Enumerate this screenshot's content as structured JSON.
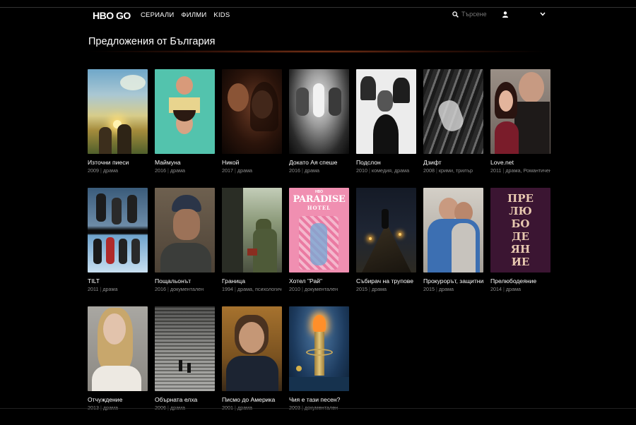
{
  "nav": {
    "logo": "HBO GO",
    "menu": [
      {
        "label": "СЕРИАЛИ"
      },
      {
        "label": "ФИЛМИ"
      },
      {
        "label": "KIDS"
      }
    ],
    "search_placeholder": "Търсене"
  },
  "page_title": "Предложения от България",
  "movies": [
    {
      "title": "Източни пиеси",
      "year": "2009",
      "genre": "драма"
    },
    {
      "title": "Маймуна",
      "year": "2016",
      "genre": "драма"
    },
    {
      "title": "Никой",
      "year": "2017",
      "genre": "драма"
    },
    {
      "title": "Докато Ая спеше",
      "year": "2016",
      "genre": "драма"
    },
    {
      "title": "Подслон",
      "year": "2010",
      "genre": "комедия, драма"
    },
    {
      "title": "Дзифт",
      "year": "2008",
      "genre": "крими, трилър"
    },
    {
      "title": "Love.net",
      "year": "2011",
      "genre": "драма, Романтичен"
    },
    {
      "title": "TILT",
      "year": "2011",
      "genre": "драма"
    },
    {
      "title": "Пощальонът",
      "year": "2016",
      "genre": "документален"
    },
    {
      "title": "Граница",
      "year": "1994",
      "genre": "драма, психологически"
    },
    {
      "title": "Хотел \"Рай\"",
      "year": "2010",
      "genre": "документален"
    },
    {
      "title": "Събирач на трупове",
      "year": "2015",
      "genre": "драма"
    },
    {
      "title": "Прокурорът, защитникът",
      "year": "2015",
      "genre": "драма"
    },
    {
      "title": "Прелюбодеяние",
      "year": "2014",
      "genre": "драма"
    },
    {
      "title": "Отчуждение",
      "year": "2013",
      "genre": "драма"
    },
    {
      "title": "Обърната елха",
      "year": "2006",
      "genre": "драма"
    },
    {
      "title": "Писмо до Америка",
      "year": "2001",
      "genre": "драма"
    },
    {
      "title": "Чия е тази песен?",
      "year": "2003",
      "genre": "документален"
    }
  ],
  "poster_text": {
    "paradise": "PARADISE",
    "hotel": "HOTEL",
    "hbo": "HBO",
    "prelu_1": "ПРЕ",
    "prelu_2": "ЛЮ",
    "prelu_3": "БО",
    "prelu_4": "ДЕ",
    "prelu_5": "ЯН",
    "prelu_6": "ИЕ"
  },
  "colors": {
    "background": "#000000",
    "glow": "#c85a28",
    "meta_text": "#8d8d8d"
  }
}
